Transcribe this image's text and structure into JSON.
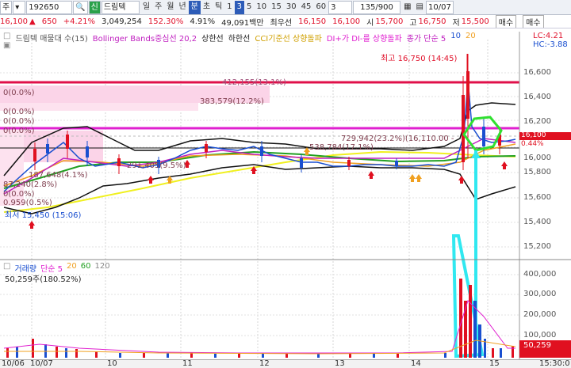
{
  "toolbar": {
    "mode": "주",
    "code": "192650",
    "badge": "신",
    "name": "드림텍",
    "periods": [
      "일",
      "주",
      "월",
      "년",
      "분",
      "초",
      "틱"
    ],
    "selected_period": "분",
    "nums": [
      "1",
      "3",
      "5",
      "10",
      "15",
      "30",
      "45",
      "60"
    ],
    "selected_num": "3",
    "interval": "3",
    "counter": "135/900",
    "date": "10/07"
  },
  "quote": {
    "price": "16,100",
    "change": "650",
    "pct": "+4.21%",
    "volume": "3,049,254",
    "vol_ratio": "152.30%",
    "turnover_ratio": "4.91%",
    "amount": "49,091백만",
    "best_label": "최우선",
    "ask": "16,150",
    "bid": "16,100",
    "open_label": "시",
    "open": "15,700",
    "high_label": "고",
    "high": "16,750",
    "low_label": "저",
    "low": "15,500",
    "sell": "매수",
    "buy": "매수"
  },
  "legend": {
    "series": "드림텍 매물대 수(15)",
    "bb": "Bollinger Bands중심선 20,2",
    "upper": "상한선",
    "lower": "하한선",
    "cci": "CCI기준선 상향돌파",
    "dmi": "DI+가 DI-를 상향돌파",
    "ma": "종가 단순 5",
    "ma10": "10",
    "ma20": "20",
    "lc": "LC:4.21",
    "hc": "HC:-3.88"
  },
  "volume_legend": {
    "label": "거래량",
    "ma": "단순 5",
    "n20": "20",
    "n60": "60",
    "n120": "120",
    "value": "50,259주(180.52%)"
  },
  "annotations": {
    "high": "최고 16,750 (14:45)",
    "low": "최저 15,450 (15:06)",
    "p1": "412,155(13.1%)",
    "p2": "383,579(12.2%)",
    "p3": "729,942(23.2%)(16,110.00 -",
    "p4": "538,784(17.1%)",
    "p5": "187,648(4.1%)",
    "p6": "87,240(2.8%)",
    "p7": "291,405(9.5%)",
    "p8": "0.959(0.5%)",
    "z1": "0(0.0%)",
    "z2": "0(0.0%)",
    "z3": "0(0.0%)",
    "z4": "0(0.0%)",
    "z5": "0(0.0%)",
    "last": "16,100",
    "last2": "0.44%"
  },
  "price_axis": [
    "16,600",
    "16,400",
    "16,200",
    "16,000",
    "15,800",
    "15,600",
    "15,400",
    "15,200"
  ],
  "vol_axis": [
    "400,000",
    "300,000",
    "200,000",
    "100,000"
  ],
  "vol_last": "50,259",
  "time_axis": [
    "10/06",
    "10/07",
    "10",
    "11",
    "12",
    "13",
    "14",
    "15"
  ],
  "time_end": "15:30:0"
}
